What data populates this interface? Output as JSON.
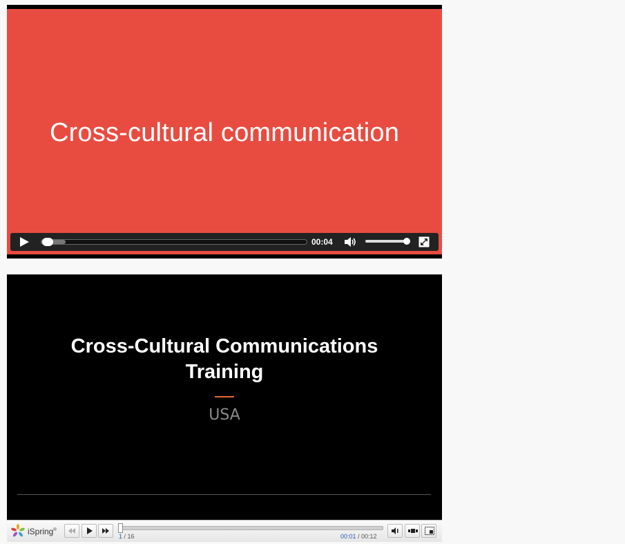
{
  "video1": {
    "title": "Cross-cultural communication",
    "time": "00:04",
    "progress": 0.09,
    "volume": 1.0,
    "background_color": "#e84c41"
  },
  "player2": {
    "slide_title_line1": "Cross-Cultural Communications",
    "slide_title_line2": "Training",
    "subtitle": "USA",
    "accent_color": "#e06a3a",
    "toolbar": {
      "logo_text": "iSpring",
      "logo_trademark": "®",
      "slide_current": "1",
      "slide_total": " / 16",
      "time_current": "00:01",
      "time_total": " / 00:12",
      "buttons": [
        "rewind-icon",
        "play-icon",
        "fast-forward-icon",
        "volume-icon",
        "layout-icon",
        "fullscreen-icon"
      ]
    }
  }
}
